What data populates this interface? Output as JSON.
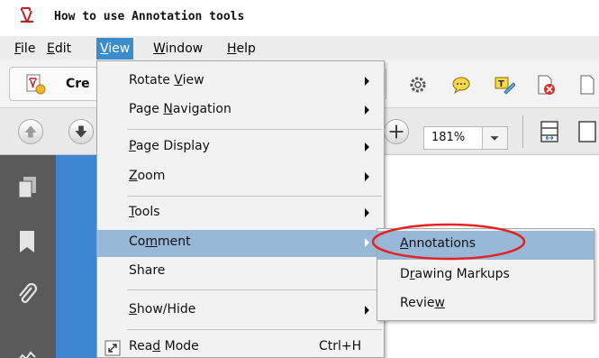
{
  "window": {
    "title": "How to use Annotation tools"
  },
  "menubar": {
    "items": [
      {
        "label": "File",
        "accel": "F",
        "rest": "ile"
      },
      {
        "label": "Edit",
        "accel": "E",
        "rest": "dit"
      },
      {
        "label": "View",
        "accel": "V",
        "rest": "iew"
      },
      {
        "label": "Window",
        "accel": "W",
        "rest": "indow"
      },
      {
        "label": "Help",
        "accel": "H",
        "rest": "elp"
      }
    ]
  },
  "toolbar": {
    "create_label": "Cre",
    "zoom_value": "181%"
  },
  "view_menu": {
    "items": [
      {
        "pre": "Rotate ",
        "accel": "V",
        "post": "iew"
      },
      {
        "pre": "Page ",
        "accel": "N",
        "post": "avigation"
      },
      {
        "pre": "",
        "accel": "P",
        "post": "age Display"
      },
      {
        "pre": "",
        "accel": "Z",
        "post": "oom"
      },
      {
        "pre": "",
        "accel": "T",
        "post": "ools"
      },
      {
        "pre": "Co",
        "accel": "m",
        "post": "ment"
      },
      {
        "pre": "Share",
        "accel": "",
        "post": ""
      },
      {
        "pre": "",
        "accel": "S",
        "post": "how/Hide"
      },
      {
        "pre": "Rea",
        "accel": "d",
        "post": " Mode",
        "shortcut": "Ctrl+H"
      }
    ]
  },
  "comment_submenu": {
    "items": [
      {
        "pre": "",
        "accel": "A",
        "post": "nnotations"
      },
      {
        "pre": "D",
        "accel": "r",
        "post": "awing Markups"
      },
      {
        "pre": "Revie",
        "accel": "w",
        "post": ""
      }
    ]
  },
  "colors": {
    "menu_active": "#3c8ccd",
    "menu_highlight": "#97b8d6",
    "annotation_ring": "#e32323",
    "doc_blue": "#3d86d1",
    "nav_pane": "#5a5a5a"
  }
}
